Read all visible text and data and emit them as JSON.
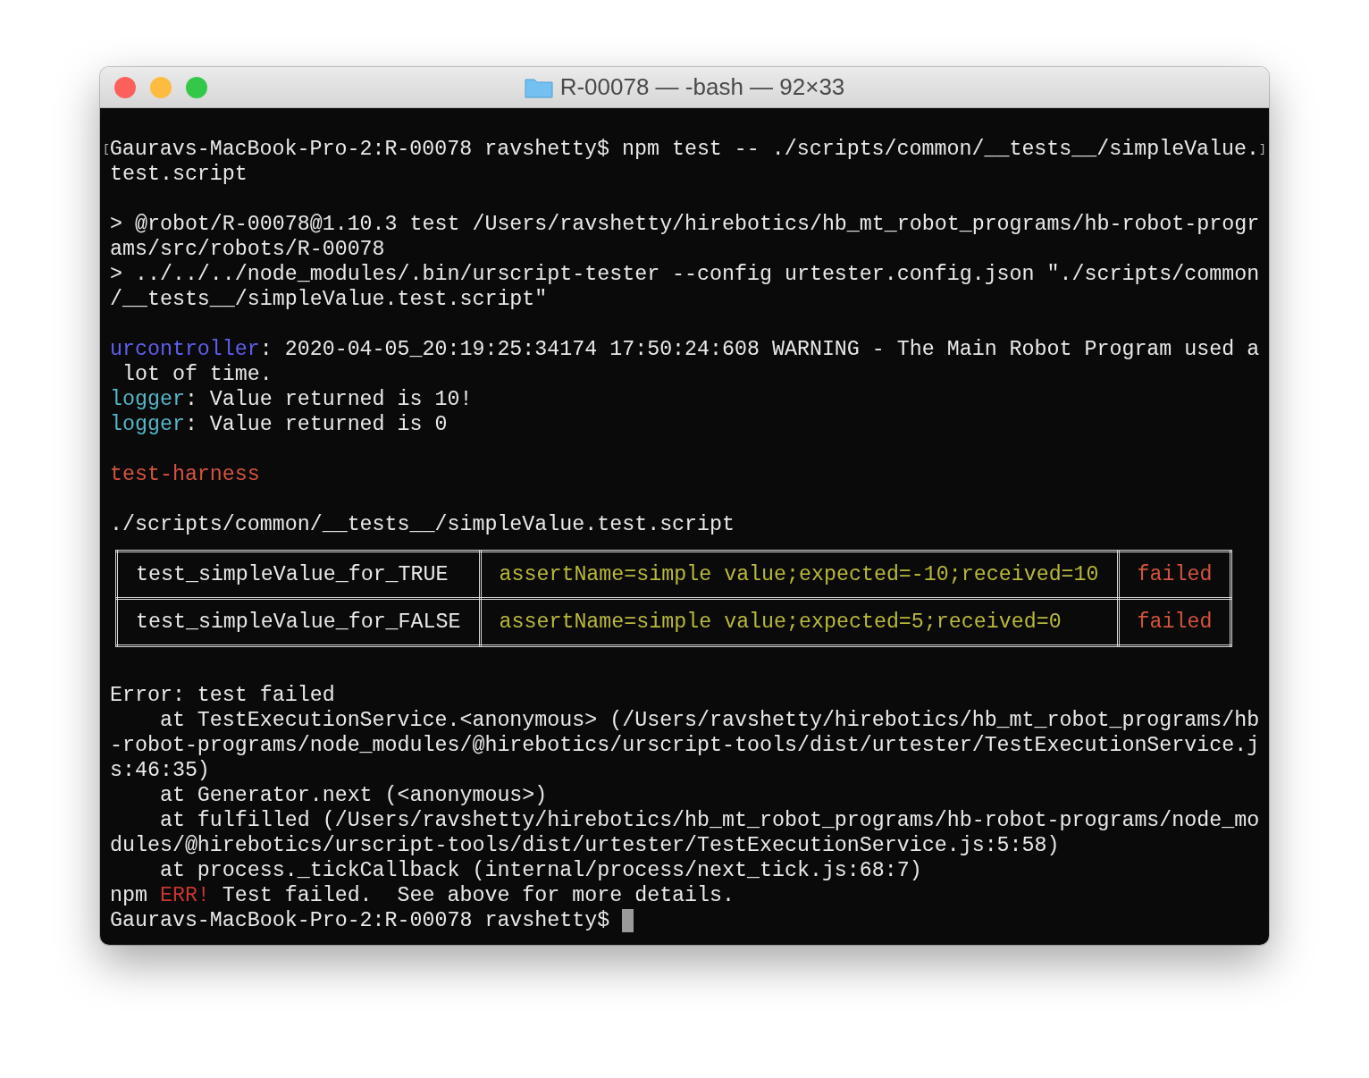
{
  "window": {
    "title": "R-00078 — -bash — 92×33"
  },
  "output_before": [
    {
      "lines": [
        {
          "segments": [
            {
              "kind": "mark",
              "text": "["
            },
            {
              "kind": "plain",
              "text": "Gauravs-MacBook-Pro-2:R-00078 ravshetty$ npm test -- ./scripts/common/__tests__/simpleValue."
            },
            {
              "kind": "mark",
              "text": "]"
            }
          ]
        },
        {
          "segments": [
            {
              "kind": "plain",
              "text": "test.script"
            }
          ]
        }
      ]
    },
    {
      "lines": [
        {
          "segments": [
            {
              "kind": "plain",
              "text": "> @robot/R-00078@1.10.3 test /Users/ravshetty/hirebotics/hb_mt_robot_programs/hb-robot-progr"
            }
          ]
        },
        {
          "segments": [
            {
              "kind": "plain",
              "text": "ams/src/robots/R-00078"
            }
          ]
        },
        {
          "segments": [
            {
              "kind": "plain",
              "text": "> ../../../node_modules/.bin/urscript-tester --config urtester.config.json \"./scripts/common"
            }
          ]
        },
        {
          "segments": [
            {
              "kind": "plain",
              "text": "/__tests__/simpleValue.test.script\""
            }
          ]
        }
      ]
    },
    {
      "lines": [
        {
          "segments": [
            {
              "kind": "controller",
              "text": "urcontroller"
            },
            {
              "kind": "plain",
              "text": ": 2020-04-05_20:19:25:34174 17:50:24:608 WARNING - The Main Robot Program used a"
            }
          ]
        },
        {
          "segments": [
            {
              "kind": "plain",
              "text": " lot of time."
            }
          ]
        },
        {
          "segments": [
            {
              "kind": "logger",
              "text": "logger"
            },
            {
              "kind": "plain",
              "text": ": Value returned is 10!"
            }
          ]
        },
        {
          "segments": [
            {
              "kind": "logger",
              "text": "logger"
            },
            {
              "kind": "plain",
              "text": ": Value returned is 0"
            }
          ]
        }
      ]
    },
    {
      "lines": [
        {
          "segments": [
            {
              "kind": "harness",
              "text": "test-harness"
            }
          ]
        }
      ]
    },
    {
      "lines": [
        {
          "segments": [
            {
              "kind": "plain",
              "text": "./scripts/common/__tests__/simpleValue.test.script"
            }
          ]
        }
      ]
    }
  ],
  "results_table": {
    "rows": [
      {
        "test": "test_simpleValue_for_TRUE",
        "assertion": "assertName=simple value;expected=-10;received=10",
        "status": "failed"
      },
      {
        "test": "test_simpleValue_for_FALSE",
        "assertion": "assertName=simple value;expected=5;received=0",
        "status": "failed"
      }
    ]
  },
  "output_after": [
    {
      "lines": [
        {
          "segments": [
            {
              "kind": "plain",
              "text": "Error: test failed"
            }
          ]
        },
        {
          "segments": [
            {
              "kind": "plain",
              "text": "    at TestExecutionService.<anonymous> (/Users/ravshetty/hirebotics/hb_mt_robot_programs/hb"
            }
          ]
        },
        {
          "segments": [
            {
              "kind": "plain",
              "text": "-robot-programs/node_modules/@hirebotics/urscript-tools/dist/urtester/TestExecutionService.j"
            }
          ]
        },
        {
          "segments": [
            {
              "kind": "plain",
              "text": "s:46:35)"
            }
          ]
        },
        {
          "segments": [
            {
              "kind": "plain",
              "text": "    at Generator.next (<anonymous>)"
            }
          ]
        },
        {
          "segments": [
            {
              "kind": "plain",
              "text": "    at fulfilled (/Users/ravshetty/hirebotics/hb_mt_robot_programs/hb-robot-programs/node_mo"
            }
          ]
        },
        {
          "segments": [
            {
              "kind": "plain",
              "text": "dules/@hirebotics/urscript-tools/dist/urtester/TestExecutionService.js:5:58)"
            }
          ]
        },
        {
          "segments": [
            {
              "kind": "plain",
              "text": "    at process._tickCallback (internal/process/next_tick.js:68:7)"
            }
          ]
        },
        {
          "segments": [
            {
              "kind": "plain",
              "text": "npm "
            },
            {
              "kind": "err",
              "text": "ERR!"
            },
            {
              "kind": "plain",
              "text": " Test failed.  See above for more details."
            }
          ]
        },
        {
          "segments": [
            {
              "kind": "plain",
              "text": "Gauravs-MacBook-Pro-2:R-00078 ravshetty$ "
            },
            {
              "kind": "cursor"
            }
          ]
        }
      ]
    }
  ]
}
